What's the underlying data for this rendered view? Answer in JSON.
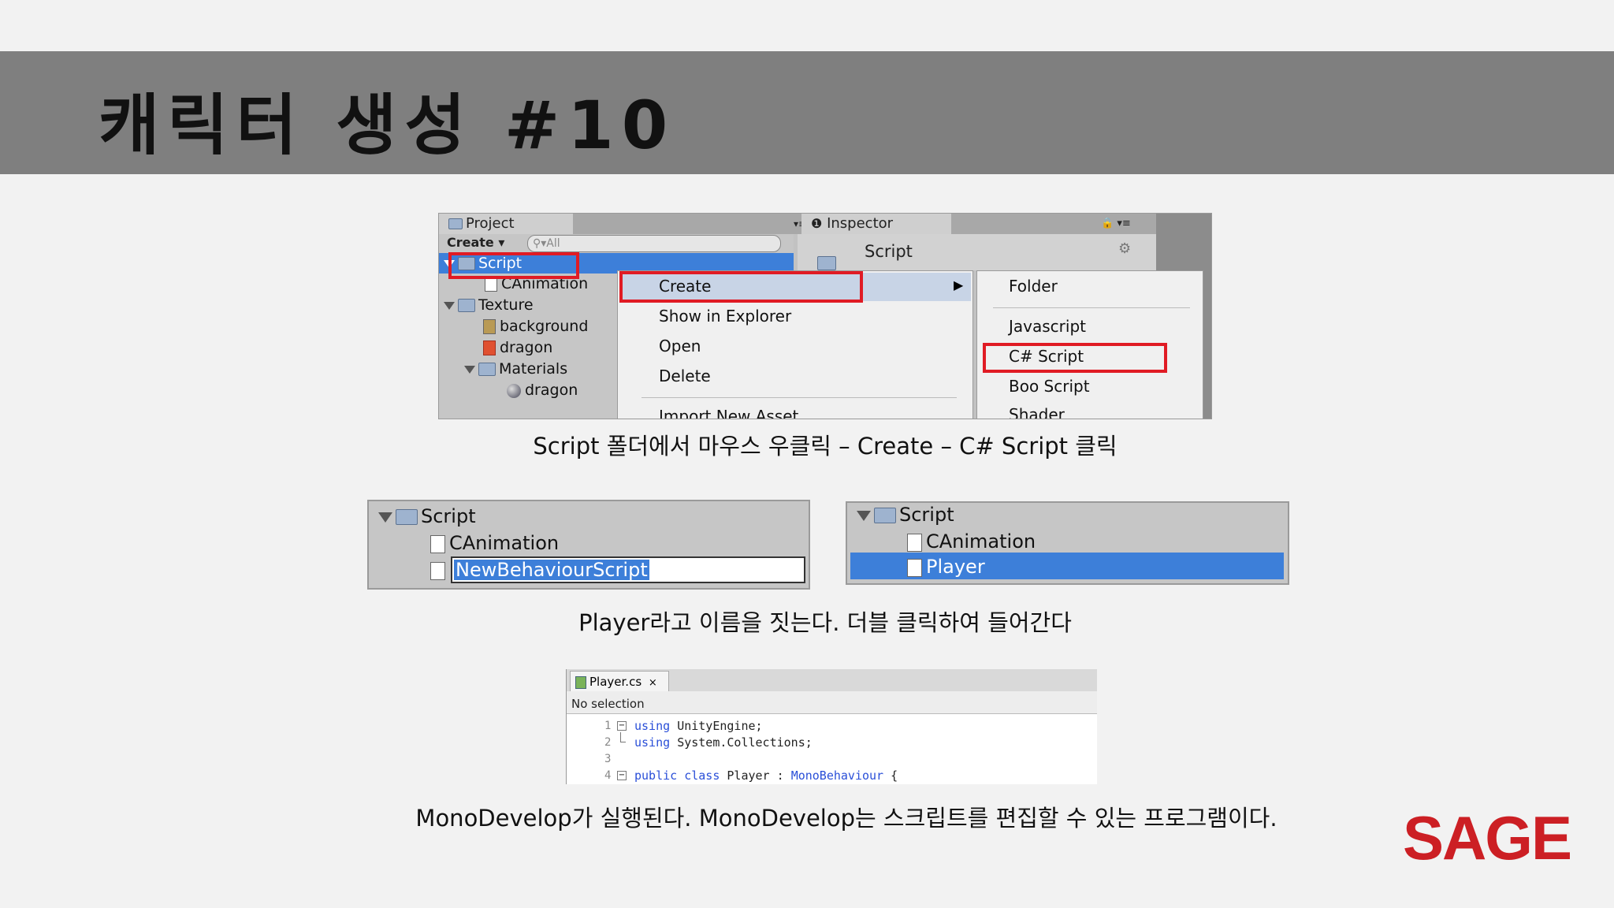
{
  "slide": {
    "title": "캐릭터 생성 #10",
    "logo": "SAGE",
    "captions": [
      "Script 폴더에서 마우스 우클릭 – Create – C# Script 클릭",
      "Player라고 이름을 짓는다. 더블 클릭하여 들어간다",
      "MonoDevelop가 실행된다. MonoDevelop는 스크립트를 편집할 수 있는 프로그램이다."
    ]
  },
  "shot1": {
    "project_tab": "Project",
    "create_button": "Create",
    "search_placeholder": "All",
    "tree": [
      "Script",
      "CAnimation",
      "Texture",
      "background",
      "dragon",
      "Materials",
      "dragon"
    ],
    "inspector_tab": "Inspector",
    "inspector_title": "Script",
    "context_menu": [
      "Create",
      "Show in Explorer",
      "Open",
      "Delete",
      "Import New Asset"
    ],
    "submenu": [
      "Folder",
      "Javascript",
      "C# Script",
      "Boo Script",
      "Shader"
    ]
  },
  "shot2": {
    "left": {
      "folder": "Script",
      "file": "CAnimation",
      "editing": "NewBehaviourScript"
    },
    "right": {
      "folder": "Script",
      "file": "CAnimation",
      "selected": "Player"
    }
  },
  "shot3": {
    "tab": "Player.cs",
    "close": "×",
    "selection": "No selection",
    "lines": [
      {
        "n": "1",
        "kw": "using",
        "rest": "UnityEngine;"
      },
      {
        "n": "2",
        "kw": "using",
        "rest": "System.Collections;"
      },
      {
        "n": "3",
        "kw": "",
        "rest": ""
      },
      {
        "n": "4",
        "kw": "public class",
        "rest": "Player : ",
        "type": "MonoBehaviour",
        "tail": " {"
      }
    ]
  },
  "colors": {
    "accent_red": "#e01b24",
    "selection_blue": "#3d7fd9",
    "logo_red": "#cc1f24",
    "title_bar": "#7f7f7f"
  }
}
